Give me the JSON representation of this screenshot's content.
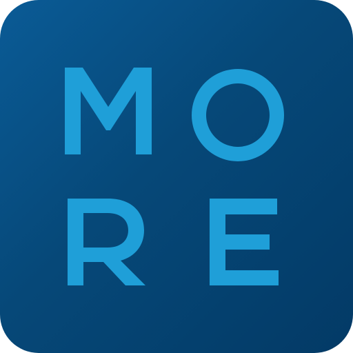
{
  "app_icon": {
    "name": "MORE",
    "letters": [
      "M",
      "O",
      "R",
      "E"
    ],
    "colors": {
      "background_start": "#0a5b96",
      "background_end": "#033a66",
      "letter": "#1f9fd8"
    }
  }
}
